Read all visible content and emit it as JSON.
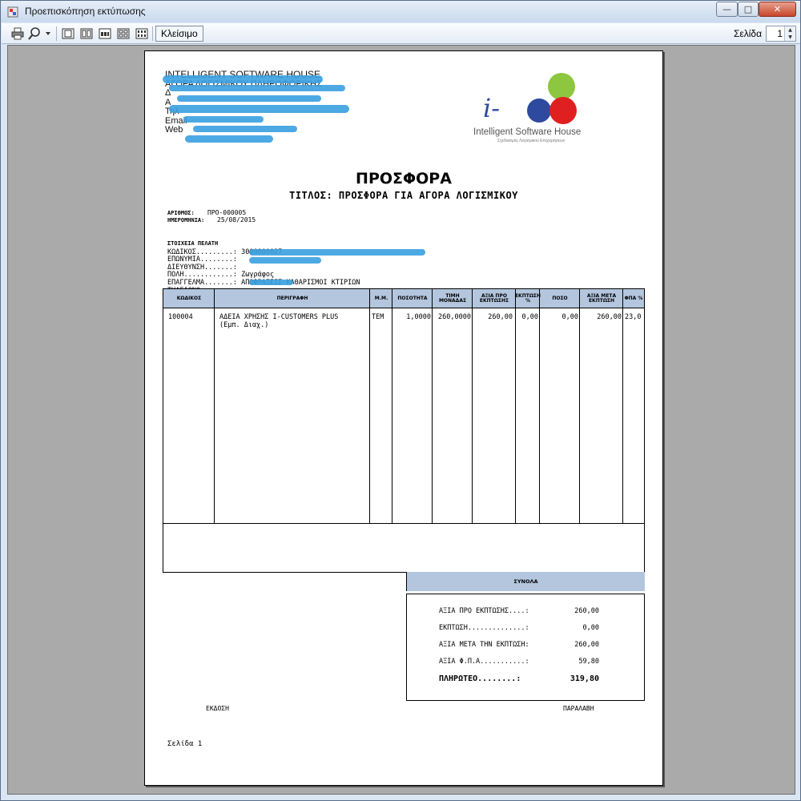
{
  "window": {
    "title": "Προεπισκόπηση εκτύπωσης",
    "min_symbol": "—",
    "max_symbol": "□",
    "close_symbol": "✕"
  },
  "toolbar": {
    "close_label": "Κλείσιμο",
    "page_label": "Σελίδα",
    "page_value": "1",
    "icons": [
      "printer-icon",
      "zoom-icon",
      "one-page-icon",
      "two-pages-icon",
      "three-pages-icon",
      "four-pages-icon",
      "six-pages-icon"
    ]
  },
  "company": {
    "name": "INTELLIGENT SOFTWARE HOUSE",
    "line2": "",
    "line3": "ΑΓΟΡΑ ΛΟΓΙΣΜΙΚΟΥ ΠΛΗΡΟΦΟΡΙΚΗΣ",
    "line4": "Δ",
    "line5": "Α",
    "phone_label": "Τηλ",
    "email_label": "Email",
    "web_label": "Web"
  },
  "logo": {
    "mark": "i-",
    "text": "Intelligent Software House",
    "sub": "Σχεδιασμός Λογισμικού Επιχειρήσεων",
    "colors": [
      "#8dc63f",
      "#2e4a9e",
      "#e02020"
    ]
  },
  "document": {
    "title": "ΠΡΟΣΦΟΡΑ",
    "subtitle": "ΤΙΤΛΟΣ: ΠΡΟΣΦΟΡΑ ΓΙΑ ΑΓΟΡΑ ΛΟΓΙΣΜΙΚΟΥ",
    "number_label": "ΑΡΙΘΜΟΣ:",
    "number": "ΠΡΟ-000005",
    "date_label": "ΗΜΕΡΟΜΗΝΙΑ:",
    "date": "25/08/2015"
  },
  "customer": {
    "header": "ΣΤΟΙΧΕΙΑ ΠΕΛΑΤΗ",
    "code_label": "ΚΩΔΙΚΟΣ.........:",
    "code": "3000000027",
    "name_label": "ΕΠΩΝΥΜΙΑ........:",
    "address_label": "ΔΙΕΥΘΥΝΣΗ.......:",
    "city_label": "ΠΟΛΗ............:",
    "city": "Ζωγράφος",
    "profession_label": "ΕΠΑΓΓΕΛΜΑ.......:",
    "profession": "ΑΠΟΦΡΑΞΕΙΣ-ΚΑΘΑΡΙΣΜΟΙ ΚΤΙΡΙΩΝ",
    "phone_label": "ΤΗΛΕΦΩΝΟ........:"
  },
  "table": {
    "headers": [
      "ΚΩΔΙΚΟΣ",
      "ΠΕΡΙΓΡΑΦΗ",
      "Μ.Μ.",
      "ΠΟΣΟΤΗΤΑ",
      "ΤΙΜΗ ΜΟΝΑΔΑΣ",
      "ΑΞΙΑ ΠΡΟ ΕΚΠΤΩΣΗΣ",
      "ΕΚΠΤΩΣΗ %",
      "ΠΟΣΟ",
      "ΑΞΙΑ ΜΕΤΑ ΕΚΠΤΩΣΗ",
      "ΦΠΑ %"
    ],
    "rows": [
      {
        "code": "100004",
        "description": "ΑΔΕΙΑ ΧΡΗΣΗΣ I-CUSTOMERS PLUS",
        "description2": "(Εμπ. Διαχ.)",
        "unit": "ΤΕΜ",
        "qty": "1,0000",
        "price": "260,0000",
        "gross": "260,00",
        "disc_pct": "0,00",
        "disc_amt": "0,00",
        "net": "260,00",
        "vat": "23,0"
      }
    ]
  },
  "totals": {
    "header": "ΣΥΝΟΛΑ",
    "gross_label": "ΑΞΙΑ ΠΡΟ ΕΚΠΤΩΣΗΣ....:",
    "gross": "260,00",
    "disc_label": "ΕΚΠΤΩΣΗ..............:",
    "disc": "0,00",
    "net_label": "ΑΞΙΑ ΜΕΤΑ ΤΗΝ ΕΚΠΤΩΣΗ:",
    "net": "260,00",
    "vat_label": "ΑΞΙΑ Φ.Π.Α...........:",
    "vat": "59,80",
    "payable_label": "ΠΛΗΡΩΤΕΟ........:",
    "payable": "319,80"
  },
  "footer": {
    "issuer": "ΕΚΔΟΣΗ",
    "receiver": "ΠΑΡΑΛΑΒΗ",
    "page": "Σελίδα 1"
  }
}
